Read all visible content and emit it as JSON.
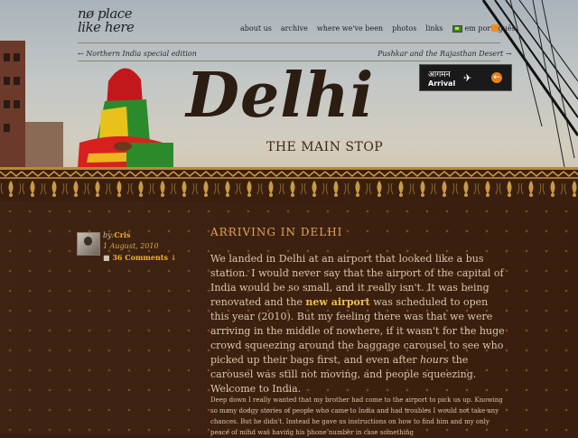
{
  "header": {
    "logo_line1": "nø place",
    "logo_line2": "like here",
    "nav": [
      "about us",
      "archive",
      "where we've been",
      "photos",
      "links"
    ],
    "lang_link": "em português",
    "prev_link": "Northern India special edition",
    "next_link": "Pushkar and the Rajasthan Desert",
    "title": "Delhi",
    "subtitle": "THE MAIN STOP",
    "sign": {
      "hindi": "आगमन",
      "english": "Arrival"
    }
  },
  "post": {
    "author_prefix": "by:",
    "author": "Cris",
    "date": "1 August, 2010",
    "comments": "36 Comments",
    "title": "ARRIVING IN DELHI",
    "p1_a": "We landed in Delhi at an airport that looked like a bus station. I would never say that the airport of the capital of India would be so small, and it really isn't. It was being renovated and the ",
    "p1_link": "new airport",
    "p1_b": " was scheduled to open this year (2010). But my feeling there was that we were arriving in the middle of nowhere, if it wasn't for the huge crowd squeezing around the baggage carousel to see who picked up their bags first, and even after ",
    "p1_em": "hours",
    "p1_c": " the carousel was still not moving, and people squeezing. Welcome to India.",
    "p2": "Deep down I really wanted that my brother had come to the airport to pick us up. Knowing so many dodgy stories of people who came to India and had troubles I would not take any chances. But he didn't. Instead he gave us instructions on how to find him and my only peace of mind was having his phone number in case something"
  },
  "colors": {
    "accent": "#f0b422",
    "title": "#dfa35a",
    "background": "#3b1f0e"
  }
}
